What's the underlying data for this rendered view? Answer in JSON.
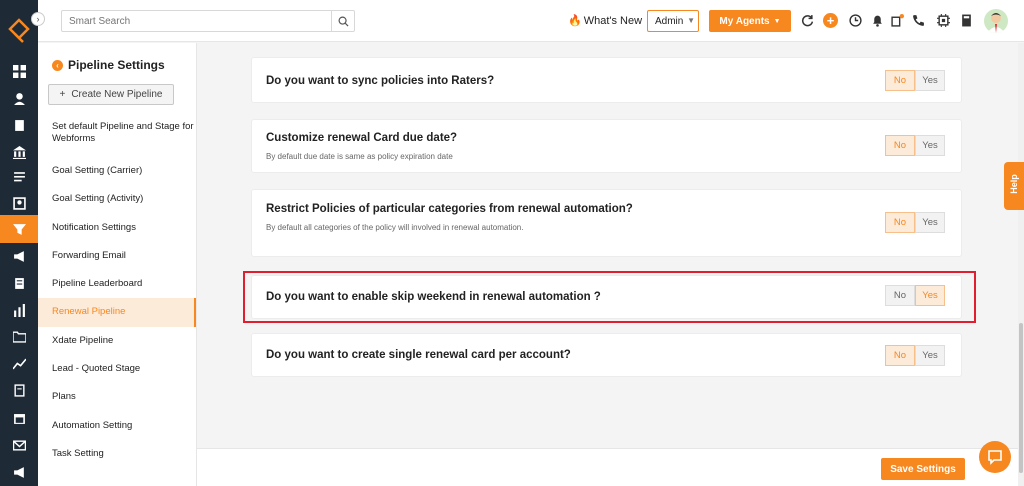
{
  "topbar": {
    "search_placeholder": "Smart Search",
    "whats_new": "What's New",
    "admin_label": "Admin",
    "my_agents_label": "My Agents"
  },
  "sidebar": {
    "title": "Pipeline Settings",
    "create_label": "Create New Pipeline",
    "items": [
      {
        "label": "Set default Pipeline and Stage for Webforms",
        "active": false
      },
      {
        "label": "Goal Setting (Carrier)",
        "active": false
      },
      {
        "label": "Goal Setting (Activity)",
        "active": false
      },
      {
        "label": "Notification Settings",
        "active": false
      },
      {
        "label": "Forwarding Email",
        "active": false
      },
      {
        "label": "Pipeline Leaderboard",
        "active": false
      },
      {
        "label": "Renewal Pipeline",
        "active": true
      },
      {
        "label": "Xdate Pipeline",
        "active": false
      },
      {
        "label": "Lead - Quoted Stage",
        "active": false
      },
      {
        "label": "Plans",
        "active": false
      },
      {
        "label": "Automation Setting",
        "active": false
      },
      {
        "label": "Task Setting",
        "active": false
      }
    ]
  },
  "settings": [
    {
      "question": "Do you want to sync policies into Raters?",
      "sub": "",
      "selected": "No"
    },
    {
      "question": "Customize renewal Card due date?",
      "sub": "By default due date is same as policy expiration date",
      "selected": "No"
    },
    {
      "question": "Restrict Policies of particular categories from renewal automation?",
      "sub": "By default all categories of the policy will involved in renewal automation.",
      "selected": "No"
    },
    {
      "question": "Do you want to enable skip weekend in renewal automation ?",
      "sub": "",
      "selected": "Yes"
    },
    {
      "question": "Do you want to create single renewal card per account?",
      "sub": "",
      "selected": "No"
    }
  ],
  "toggle_labels": {
    "no": "No",
    "yes": "Yes"
  },
  "save_label": "Save Settings",
  "help_label": "Help",
  "colors": {
    "accent": "#f7871f",
    "rail": "#1f2a37",
    "highlight": "#e01e2f"
  }
}
